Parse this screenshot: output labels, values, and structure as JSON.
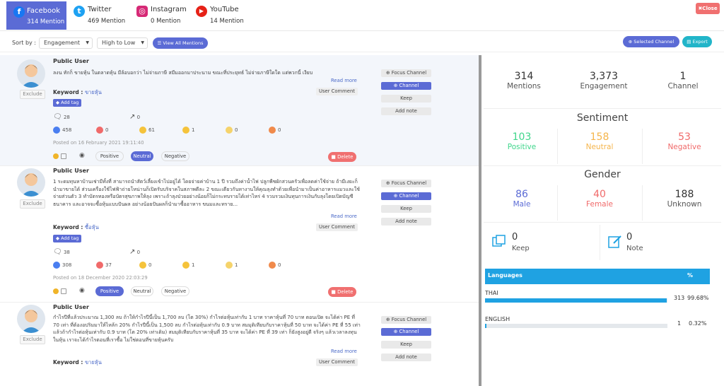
{
  "tabs": [
    {
      "name": "Facebook",
      "mentions": "314 Mention"
    },
    {
      "name": "Twitter",
      "mentions": "469 Mention"
    },
    {
      "name": "Instagram",
      "mentions": "0 Mention"
    },
    {
      "name": "YouTube",
      "mentions": "14 Mention"
    }
  ],
  "close_label": "✖Close",
  "sort": {
    "label": "Sort by :",
    "field": "Engagement",
    "order": "High to Low",
    "view_all": "View All Mentions",
    "selected_channel": "Selected Channel",
    "export": "Export"
  },
  "posts": [
    {
      "user": "Public User",
      "text": "ลงน ทักก็ ขายหุ้น ในตลาดหุ้น มีล้อบอกว่า ไม่จ่ายภาษี สมีมออกมาประนาม ขณะที่ประยุทธ์ ไม่จ่ายภาษีใดใด แต่พวกนี้ เงียบ",
      "read_more": "Read more",
      "keyword_label": "Keyword :",
      "keyword": "ขายหุ้น",
      "add_tag": "Add tag",
      "source_type": "User Comment",
      "comments": "28",
      "shares": "0",
      "reactions": [
        "458",
        "0",
        "61",
        "1",
        "0",
        "0"
      ],
      "posted": "Posted on 16 February 2021 19:11:40",
      "sentiment": "Neutral",
      "exclude": "Exclude"
    },
    {
      "user": "Public User",
      "text": "1 ระดมทุนหาบ้านเช่ามีทั้งที่ สามารถนำสัตว์เลี้ยงเข้าไปอยู่ได้ โดยจ่ายค่าบ้าน 1 ปี รวมถึงค่าน้ำไฟ ปลูกพืชผักสวนครัวเพื่อลดค่าใช้จ่าย ถ้ามีเงยะก็นำมาขายได้ ส่วนเครื่องใช้ไฟฟ้าถ่ายโหน่านก็เปิดรับบริจาคในสภาพดีละ 2 ขณะเดียวกันหางานให้คุณลุงทำด้วยเพื่อนำมาเป็นค่าอาหารแมวและใช้จ่ายส่วนตัว 3 ทำบัตรทองหรือบัตรสุขภาพให้ลุง เพราะถ้าลุงป่วยอย่างน้อยก็ไม่กระทบรายได้เท่าไหร่ 4 รวมรวมเงินทุนการเงินกับลุงโดยเปิดบัญชีธนาคาร และอาจจะซื้อหุ้นแบบปันผล อย่างน้อยปันผลก็นำมาซื้ออาหาร ขนมและทราย...",
      "read_more": "Read more",
      "keyword_label": "Keyword :",
      "keyword": "ซื้อหุ้น",
      "add_tag": "Add tag",
      "source_type": "User Comment",
      "comments": "38",
      "shares": "0",
      "reactions": [
        "308",
        "37",
        "0",
        "1",
        "1",
        "0"
      ],
      "posted": "Posted on 18 December 2020 22:03:29",
      "sentiment": "Positive",
      "exclude": "Exclude"
    },
    {
      "user": "Public User",
      "text": "กำไรปีที่แล้วประมาณ 1,300 ลบ ถ้าให้กำไรปีนี้เป็น 1,700 ลบ (โต 30%) กำไรต่อหุ้นเท่ากับ 1 บาท ราคาหุ้นที่ 70 บาท ตอนเปิด จะได้ค่า PE ที่ 70 เท่า ที่ต้องอปริมมาให้ไหล้ก 20% กำไรปีนี้เป็น 1,500 ลบ กำไรต่อหุ้นเท่ากับ 0.9 บาท สมมุติเทียบกับราคาหุ้นที่ 50 บาท จะได้ค่า PE ที่ 55 เท่า แล้วถ้ากำไรต่อหุ้นเท่ากับ 0.9 บาท (โต 20% เท่าเดิม) สมมุติเทียบกับราคาหุ้นที่ 35 บาท จะได้ค่า PE ที่ 39 เท่า ก็ยังสูงอยู่ดี จริงๆ แล้วเวลาลงทุนในหุ้น เราจะได้กำไรตอนที่เราซื้อ ไม่ใช่ตอนที่ขายหุ้นครับ",
      "read_more": "Read more",
      "keyword_label": "Keyword :",
      "keyword": "ขายหุ้น",
      "source_type": "User Comment",
      "exclude": "Exclude"
    }
  ],
  "post_actions": {
    "focus": "Focus Channel",
    "channel": "Channel",
    "keep": "Keep",
    "note": "Add note",
    "delete": "Delete",
    "positive": "Positive",
    "neutral": "Neutral",
    "negative": "Negative"
  },
  "summary": {
    "mentions": {
      "value": "314",
      "label": "Mentions"
    },
    "engagement": {
      "value": "3,373",
      "label": "Engagement"
    },
    "channel": {
      "value": "1",
      "label": "Channel"
    },
    "sentiment_title": "Sentiment",
    "positive": {
      "value": "103",
      "label": "Positive"
    },
    "neutral": {
      "value": "158",
      "label": "Neutral"
    },
    "negative": {
      "value": "53",
      "label": "Negative"
    },
    "gender_title": "Gender",
    "male": {
      "value": "86",
      "label": "Male"
    },
    "female": {
      "value": "40",
      "label": "Female"
    },
    "unknown": {
      "value": "188",
      "label": "Unknown"
    },
    "keep": {
      "value": "0",
      "label": "Keep"
    },
    "note": {
      "value": "0",
      "label": "Note"
    }
  },
  "languages": {
    "header": "Languages",
    "pct_header": "%",
    "rows": [
      {
        "name": "THAI",
        "count": "313",
        "pct": "99.68%",
        "fraction": 0.9968
      },
      {
        "name": "ENGLISH",
        "count": "1",
        "pct": "0.32%",
        "fraction": 0.0032
      }
    ]
  },
  "colors": {
    "accent": "#5b6bd5",
    "positive": "#3fd68b",
    "neutral": "#f5b54b",
    "negative": "#f06a6a",
    "male": "#5b6bd5",
    "female": "#f06a6a",
    "lang_bar": "#1fa2e2"
  }
}
